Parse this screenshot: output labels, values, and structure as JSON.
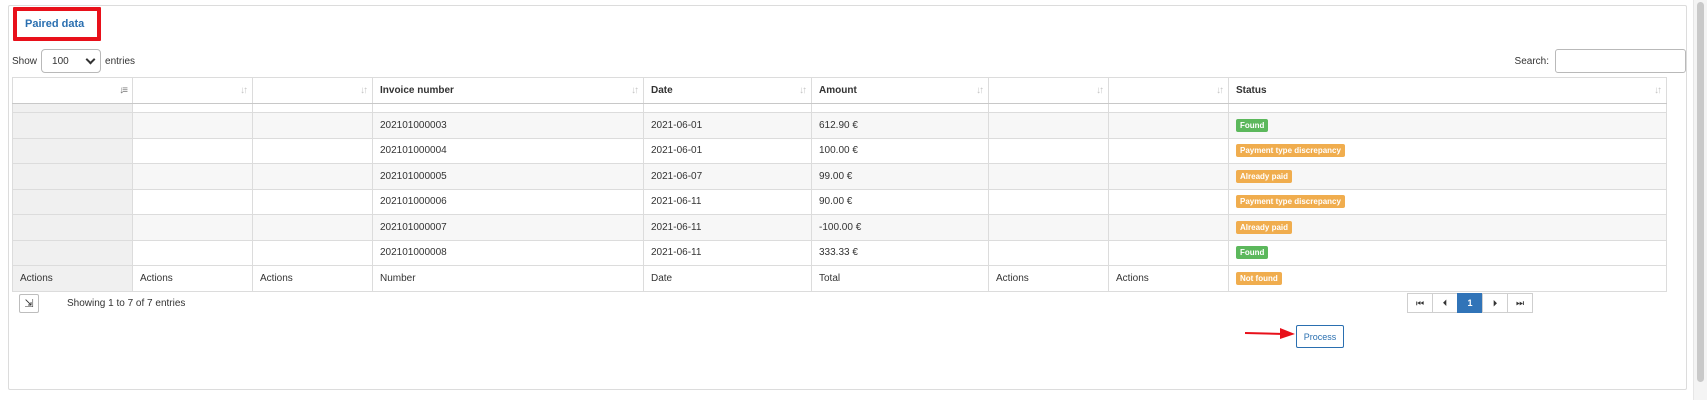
{
  "tab": {
    "label": "Paired data"
  },
  "length": {
    "show_label": "Show",
    "value": "100",
    "entries_label": "entries"
  },
  "search": {
    "label": "Search:",
    "value": ""
  },
  "table": {
    "headers": [
      "",
      "",
      "",
      "Invoice number",
      "Date",
      "Amount",
      "",
      "",
      "Status"
    ],
    "rows": [
      {
        "number": "202101000003",
        "date": "2021-06-01",
        "amount": "612.90 €",
        "status": "Found",
        "status_color": "#5cb85c"
      },
      {
        "number": "202101000004",
        "date": "2021-06-01",
        "amount": "100.00 €",
        "status": "Payment type discrepancy",
        "status_color": "#f0ad4e"
      },
      {
        "number": "202101000005",
        "date": "2021-06-07",
        "amount": "99.00 €",
        "status": "Already paid",
        "status_color": "#f0ad4e"
      },
      {
        "number": "202101000006",
        "date": "2021-06-11",
        "amount": "90.00 €",
        "status": "Payment type discrepancy",
        "status_color": "#f0ad4e"
      },
      {
        "number": "202101000007",
        "date": "2021-06-11",
        "amount": "-100.00 €",
        "status": "Already paid",
        "status_color": "#f0ad4e"
      },
      {
        "number": "202101000008",
        "date": "2021-06-11",
        "amount": "333.33 €",
        "status": "Found",
        "status_color": "#5cb85c"
      }
    ],
    "footer": [
      "Actions",
      "Actions",
      "Actions",
      "Number",
      "Date",
      "Total",
      "Actions",
      "Actions",
      "Not found"
    ],
    "footer_status_color": "#f0ad4e"
  },
  "info": {
    "text": "Showing 1 to 7 of 7 entries"
  },
  "pagination": {
    "first": "⏮",
    "prev": "⏴",
    "current": "1",
    "next": "⏵",
    "last": "⏭"
  },
  "process": {
    "label": "Process"
  },
  "colors": {
    "accent": "#3174b8",
    "highlight": "#e8101a"
  }
}
